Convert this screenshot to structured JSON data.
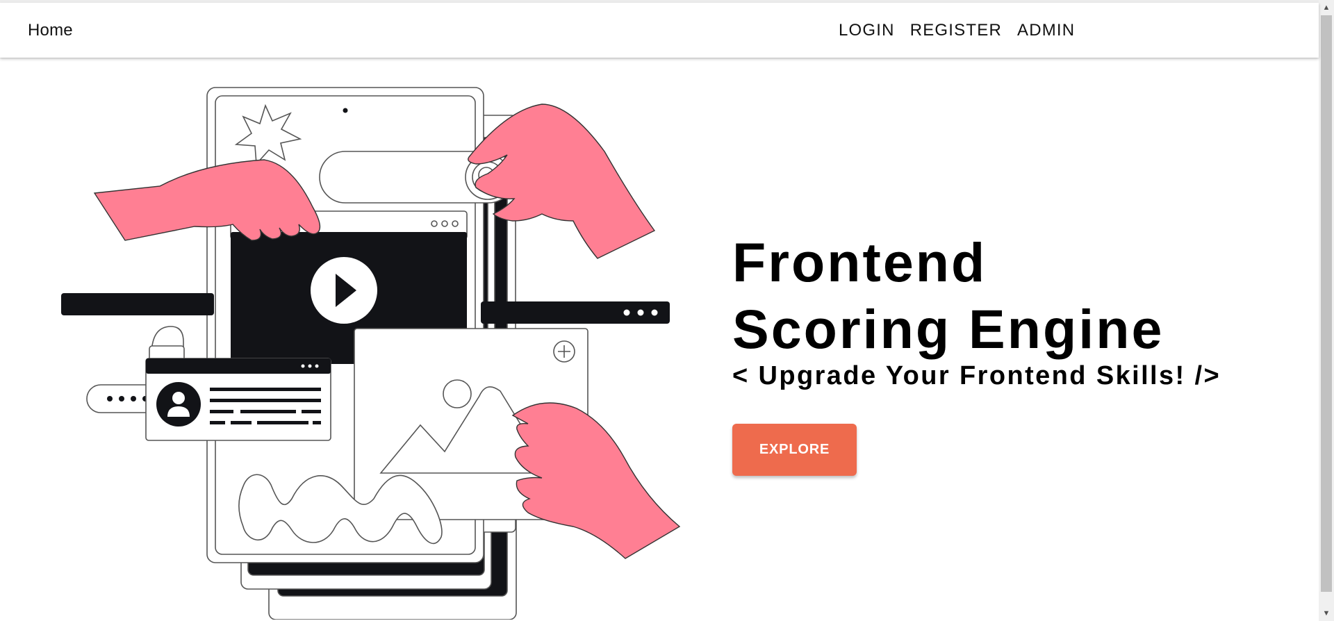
{
  "nav": {
    "home": "Home",
    "links": [
      "LOGIN",
      "REGISTER",
      "ADMIN"
    ]
  },
  "hero": {
    "title_line1": "Frontend",
    "title_line2": "Scoring Engine",
    "subtitle": "< Upgrade Your Frontend Skills! />",
    "cta": "EXPLORE"
  },
  "colors": {
    "accent": "#ee6b4d",
    "hand": "#ff7f93",
    "dark": "#121317"
  },
  "icons": [
    "play-icon",
    "search-icon",
    "user-avatar-icon",
    "lock-icon",
    "plus-icon",
    "image-icon",
    "star-icon"
  ]
}
